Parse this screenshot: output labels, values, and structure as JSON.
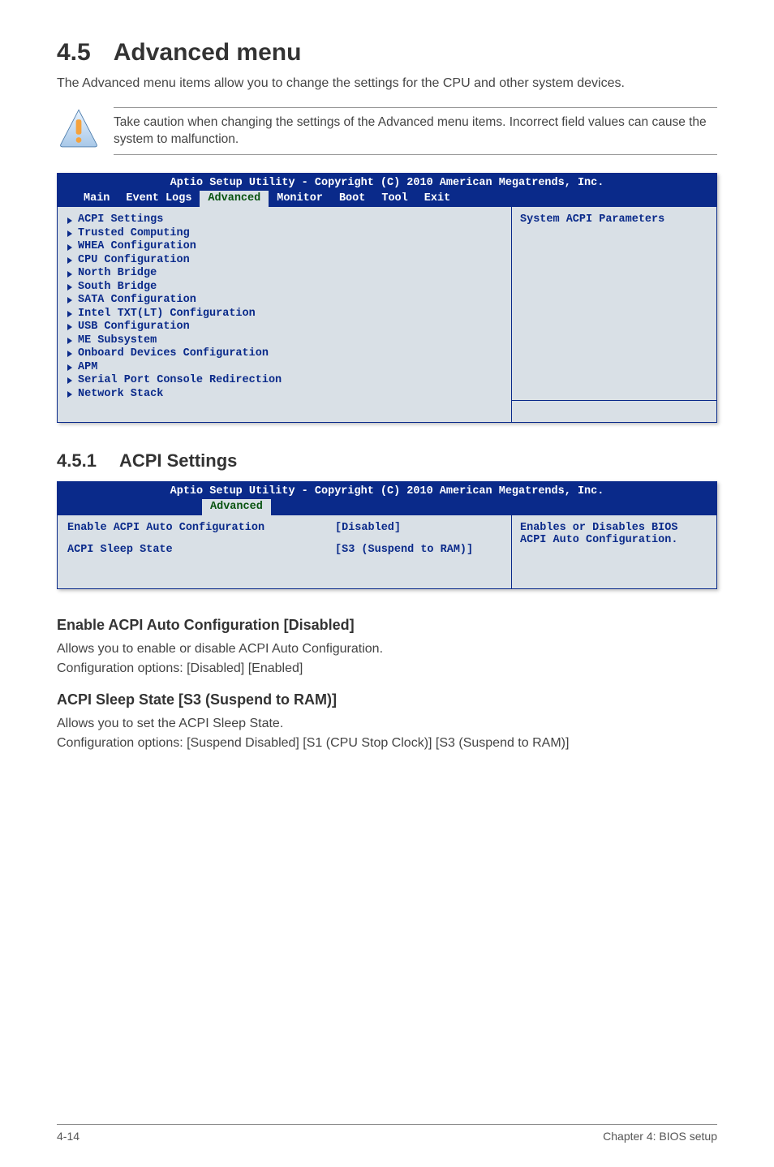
{
  "section": {
    "number": "4.5",
    "title": "Advanced menu"
  },
  "intro": "The Advanced menu items allow you to change the settings for the CPU and other system devices.",
  "note": "Take caution when changing the settings of the Advanced menu items. Incorrect field values can cause the system to malfunction.",
  "bios1": {
    "title": "Aptio Setup Utility - Copyright (C) 2010 American Megatrends, Inc.",
    "tabs": [
      "Main",
      "Event Logs",
      "Advanced",
      "Monitor",
      "Boot",
      "Tool",
      "Exit"
    ],
    "active_tab": "Advanced",
    "help": "System ACPI Parameters",
    "items": [
      "ACPI Settings",
      "Trusted Computing",
      "WHEA Configuration",
      "CPU Configuration",
      "North Bridge",
      "South Bridge",
      "SATA Configuration",
      "Intel TXT(LT) Configuration",
      "USB Configuration",
      "ME Subsystem",
      "Onboard Devices Configuration",
      "APM",
      "Serial Port Console Redirection",
      "Network Stack"
    ]
  },
  "subsection": {
    "number": "4.5.1",
    "title": "ACPI Settings"
  },
  "bios2": {
    "title": "Aptio Setup Utility - Copyright (C) 2010 American Megatrends, Inc.",
    "active_tab": "Advanced",
    "help": "Enables or Disables BIOS ACPI Auto Configuration.",
    "rows": [
      {
        "label": "Enable ACPI Auto Configuration",
        "value": "[Disabled]"
      },
      {
        "label": "ACPI Sleep State",
        "value": "[S3 (Suspend to RAM)]"
      }
    ]
  },
  "setting1": {
    "heading": "Enable ACPI Auto Configuration [Disabled]",
    "desc": "Allows you to enable or disable ACPI Auto Configuration.",
    "opts": "Configuration options: [Disabled] [Enabled]"
  },
  "setting2": {
    "heading": "ACPI Sleep State [S3 (Suspend to RAM)]",
    "desc": "Allows you to set the ACPI Sleep State.",
    "opts": "Configuration options: [Suspend Disabled] [S1 (CPU Stop Clock)] [S3 (Suspend to RAM)]"
  },
  "footer": {
    "left": "4-14",
    "right": "Chapter 4: BIOS setup"
  }
}
